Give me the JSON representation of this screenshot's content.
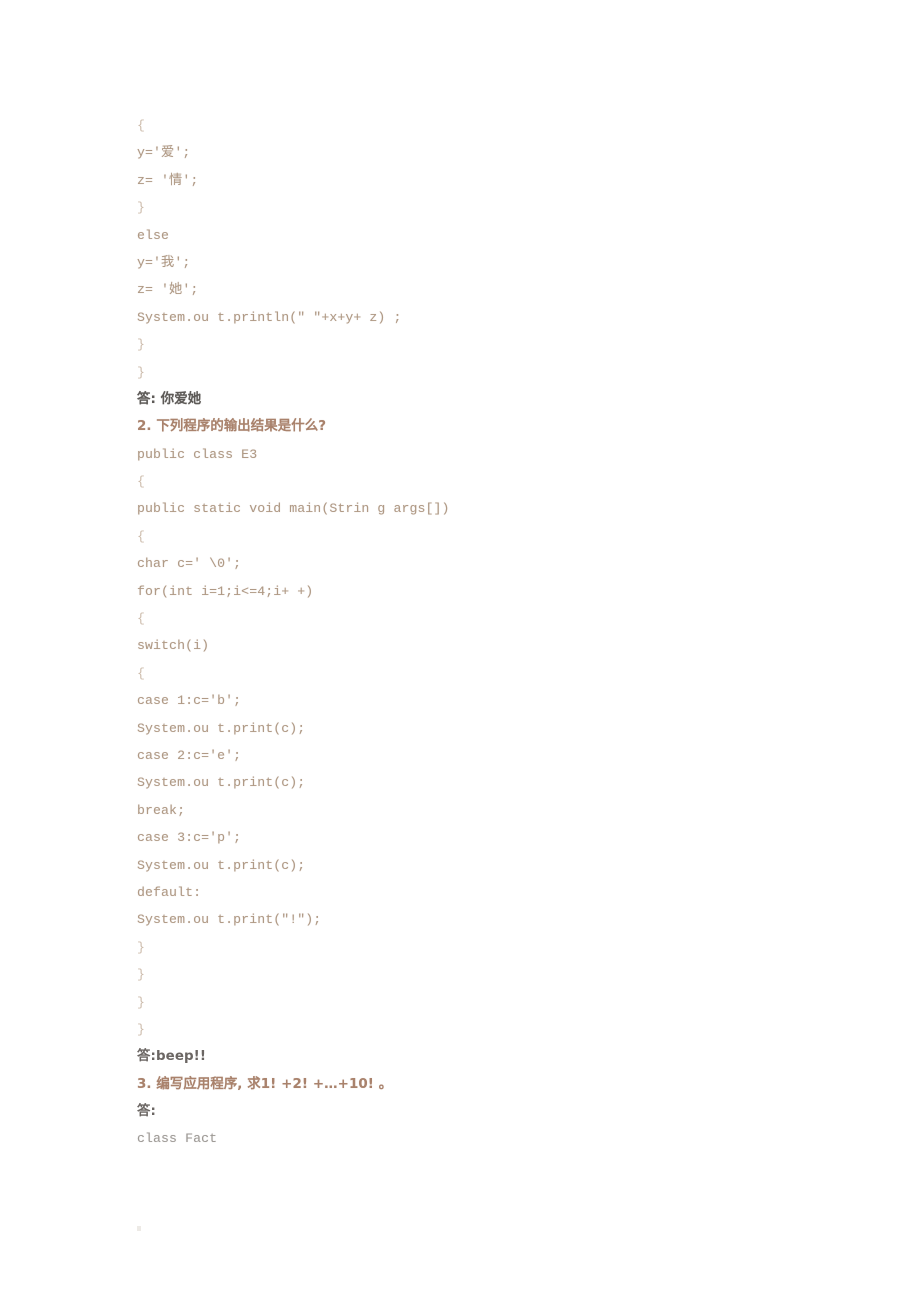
{
  "document": {
    "page_background": "#ffffff",
    "code_color": "#b09a86",
    "answer_color": "#5d5a57",
    "question_color": "#a9826c",
    "lines": [
      {
        "text": "{",
        "style": "brace"
      },
      {
        "text": "y='爱';",
        "style": "code"
      },
      {
        "text": "z= '情';",
        "style": "code"
      },
      {
        "text": "}",
        "style": "brace"
      },
      {
        "text": "else",
        "style": "code"
      },
      {
        "text": "y='我';",
        "style": "code"
      },
      {
        "text": "z= '她';",
        "style": "code"
      },
      {
        "text": "System.ou t.println(\" \"+x+y+ z) ;",
        "style": "code"
      },
      {
        "text": "}",
        "style": "brace"
      },
      {
        "text": "}",
        "style": "brace"
      },
      {
        "text": "答: 你爱她",
        "style": "cjk-dark"
      },
      {
        "text": "2. 下列程序的输出结果是什么?",
        "style": "cjk-red"
      },
      {
        "text": "public class E3",
        "style": "code"
      },
      {
        "text": "{",
        "style": "brace"
      },
      {
        "text": "public static void main(Strin g args[])",
        "style": "code"
      },
      {
        "text": "{",
        "style": "brace"
      },
      {
        "text": "char c=' \\0';",
        "style": "code"
      },
      {
        "text": "for(int i=1;i<=4;i+ +)",
        "style": "code"
      },
      {
        "text": "{",
        "style": "brace"
      },
      {
        "text": "switch(i)",
        "style": "code"
      },
      {
        "text": "{",
        "style": "brace"
      },
      {
        "text": "case 1:c='b';",
        "style": "code"
      },
      {
        "text": "System.ou t.print(c);",
        "style": "code"
      },
      {
        "text": "case 2:c='e';",
        "style": "code"
      },
      {
        "text": "System.ou t.print(c);",
        "style": "code"
      },
      {
        "text": "break;",
        "style": "code"
      },
      {
        "text": "case 3:c='p';",
        "style": "code"
      },
      {
        "text": "System.ou t.print(c);",
        "style": "code"
      },
      {
        "text": "default:",
        "style": "code"
      },
      {
        "text": "System.ou t.print(\"!\");",
        "style": "code"
      },
      {
        "text": "}",
        "style": "brace"
      },
      {
        "text": "}",
        "style": "brace"
      },
      {
        "text": "}",
        "style": "brace"
      },
      {
        "text": "}",
        "style": "brace"
      },
      {
        "text": "答:beep!!",
        "style": "cjk-mixed"
      },
      {
        "text": "3. 编写应用程序, 求1! +2! +…+10! 。",
        "style": "cjk-red"
      },
      {
        "text": "答:",
        "style": "cjk-mixed"
      },
      {
        "text": "class Fact",
        "style": "code-dark"
      }
    ]
  }
}
